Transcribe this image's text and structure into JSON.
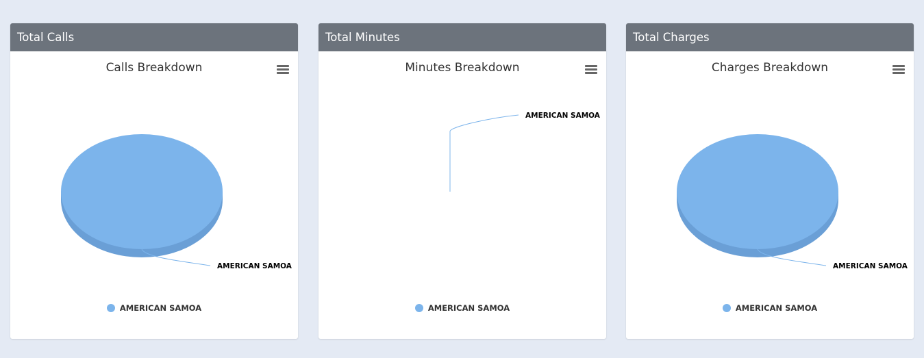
{
  "panels": [
    {
      "header": "Total Calls"
    },
    {
      "header": "Total Minutes"
    },
    {
      "header": "Total Charges"
    }
  ],
  "colors": {
    "slice": "#7cb4eb",
    "slice_side": "#6a9fd6",
    "connector": "#7cb4eb"
  },
  "chart_data": [
    {
      "type": "pie",
      "title": "Calls Breakdown",
      "categories": [
        "AMERICAN SAMOA"
      ],
      "values": [
        1
      ],
      "data_labels": [
        "AMERICAN SAMOA"
      ],
      "legend": [
        "AMERICAN SAMOA"
      ],
      "legend_position": "bottom",
      "style": "3d"
    },
    {
      "type": "pie",
      "title": "Minutes Breakdown",
      "categories": [
        "AMERICAN SAMOA"
      ],
      "values": [
        0
      ],
      "data_labels": [
        "AMERICAN SAMOA"
      ],
      "legend": [
        "AMERICAN SAMOA"
      ],
      "legend_position": "bottom",
      "style": "3d"
    },
    {
      "type": "pie",
      "title": "Charges Breakdown",
      "categories": [
        "AMERICAN SAMOA"
      ],
      "values": [
        1
      ],
      "data_labels": [
        "AMERICAN SAMOA"
      ],
      "legend": [
        "AMERICAN SAMOA"
      ],
      "legend_position": "bottom",
      "style": "3d"
    }
  ]
}
